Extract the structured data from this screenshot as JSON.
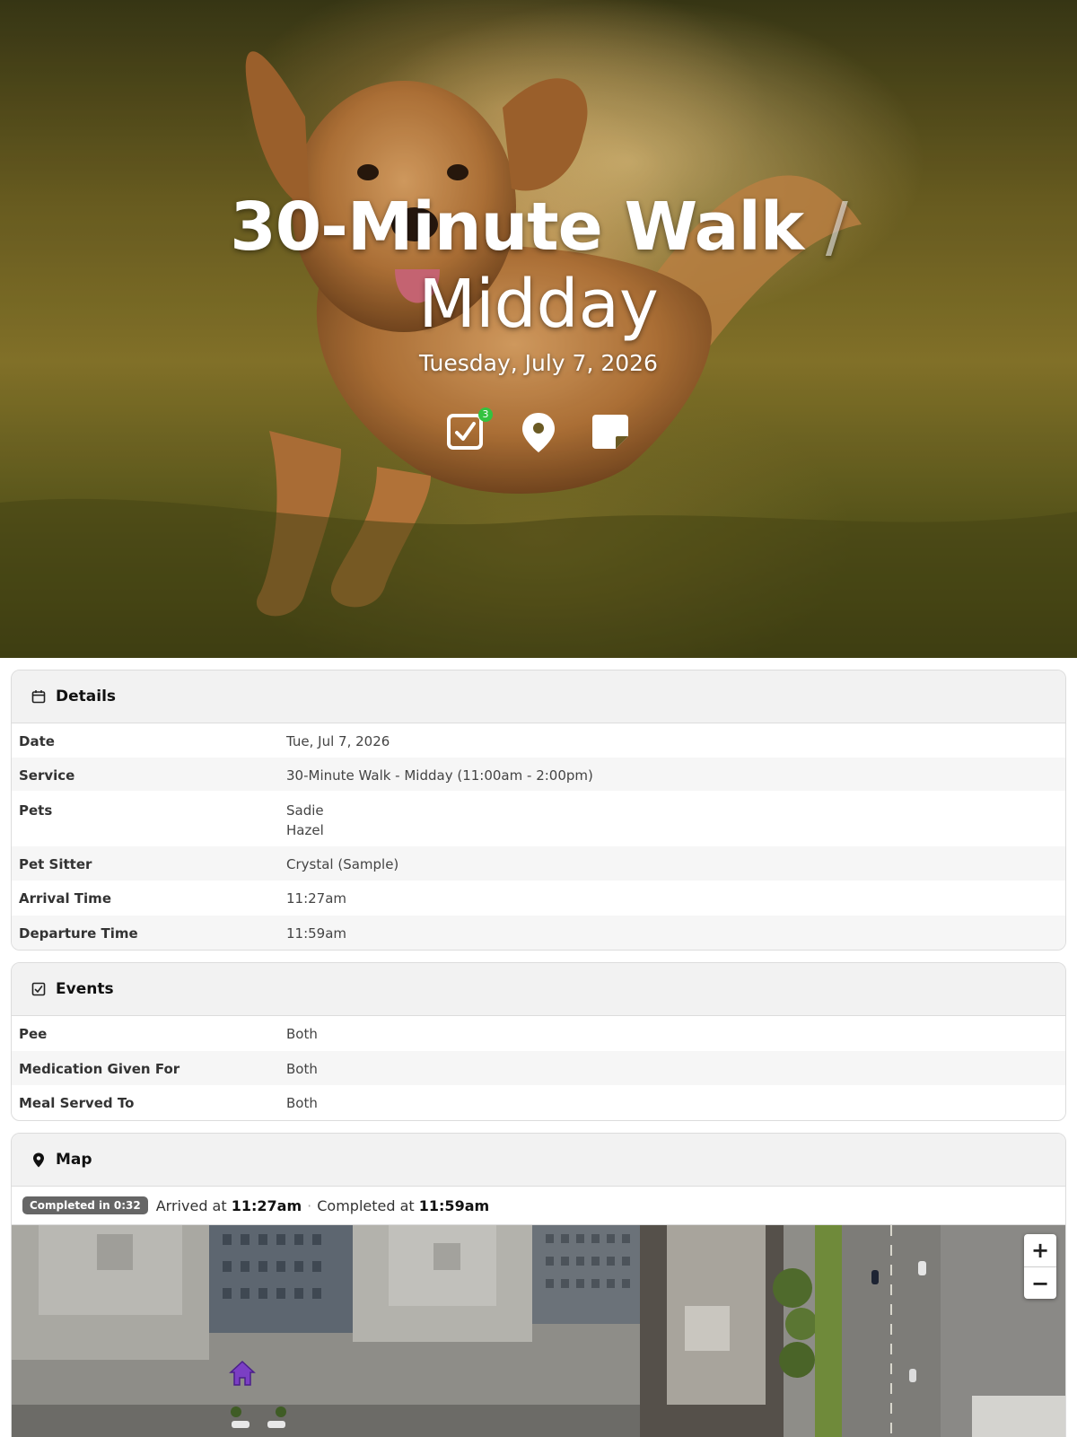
{
  "hero": {
    "title_main": "30-Minute Walk",
    "title_sep": "/",
    "title_sub": "Midday",
    "date": "Tuesday, July 7, 2026",
    "icons": [
      {
        "name": "checklist-icon",
        "badge": "3"
      },
      {
        "name": "location-pin-icon"
      },
      {
        "name": "note-icon"
      }
    ]
  },
  "details": {
    "title": "Details",
    "rows": [
      {
        "label": "Date",
        "values": [
          "Tue, Jul 7, 2026"
        ]
      },
      {
        "label": "Service",
        "values": [
          "30-Minute Walk - Midday (11:00am - 2:00pm)"
        ]
      },
      {
        "label": "Pets",
        "values": [
          "Sadie",
          "Hazel"
        ]
      },
      {
        "label": "Pet Sitter",
        "values": [
          "Crystal (Sample)"
        ]
      },
      {
        "label": "Arrival Time",
        "values": [
          "11:27am"
        ]
      },
      {
        "label": "Departure Time",
        "values": [
          "11:59am"
        ]
      }
    ]
  },
  "events": {
    "title": "Events",
    "rows": [
      {
        "label": "Pee",
        "values": [
          "Both"
        ]
      },
      {
        "label": "Medication Given For",
        "values": [
          "Both"
        ]
      },
      {
        "label": "Meal Served To",
        "values": [
          "Both"
        ]
      }
    ]
  },
  "map": {
    "title": "Map",
    "completed_pill": "Completed in 0:32",
    "arrived_prefix": "Arrived at",
    "arrived_time": "11:27am",
    "separator": "·",
    "completed_prefix": "Completed at",
    "completed_time": "11:59am",
    "zoom_in": "+",
    "zoom_out": "−"
  },
  "colors": {
    "badge_green": "#34c240",
    "pill_gray": "#666666",
    "home_marker": "#7b3fc4"
  }
}
